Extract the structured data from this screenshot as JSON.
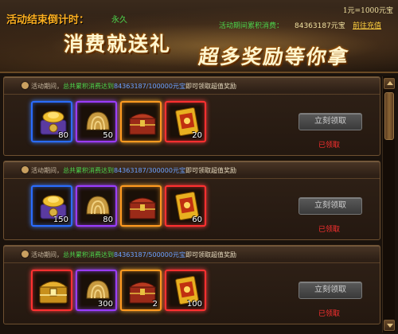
{
  "header": {
    "countdown_label": "活动结束倒计时：",
    "countdown_value": "永久",
    "rate": "1元=1000元宝",
    "total_label": "活动期间累积消费：",
    "total_value": "84363187元宝",
    "recharge_link": "前往充值",
    "slogan_left": "消费就送礼",
    "slogan_right": "超多奖励等你拿"
  },
  "tiers": [
    {
      "cond_prefix": "活动期间，",
      "cond_mid": "总共累积消费达到",
      "cond_amount": "84363187/100000元宝",
      "cond_suffix": "即可领取超值奖励",
      "button": "立刻领取",
      "status": "已领取",
      "items": [
        {
          "icon": "gold-ingot-box-icon",
          "quality": "blue",
          "qty": "80"
        },
        {
          "icon": "golden-shell-icon",
          "quality": "purple",
          "qty": "50"
        },
        {
          "icon": "treasure-chest-icon",
          "quality": "orange",
          "qty": ""
        },
        {
          "icon": "gold-voucher-icon",
          "quality": "red",
          "qty": "20"
        }
      ]
    },
    {
      "cond_prefix": "活动期间，",
      "cond_mid": "总共累积消费达到",
      "cond_amount": "84363187/300000元宝",
      "cond_suffix": "即可领取超值奖励",
      "button": "立刻领取",
      "status": "已领取",
      "items": [
        {
          "icon": "gold-ingot-box-icon",
          "quality": "blue",
          "qty": "150"
        },
        {
          "icon": "golden-shell-icon",
          "quality": "purple",
          "qty": "80"
        },
        {
          "icon": "treasure-chest-icon",
          "quality": "orange",
          "qty": ""
        },
        {
          "icon": "gold-voucher-icon",
          "quality": "red",
          "qty": "60"
        }
      ]
    },
    {
      "cond_prefix": "活动期间，",
      "cond_mid": "总共累积消费达到",
      "cond_amount": "84363187/500000元宝",
      "cond_suffix": "即可领取超值奖励",
      "button": "立刻领取",
      "status": "已领取",
      "items": [
        {
          "icon": "golden-chest-icon",
          "quality": "red",
          "qty": ""
        },
        {
          "icon": "golden-shell-icon",
          "quality": "purple",
          "qty": "300"
        },
        {
          "icon": "treasure-chest-icon",
          "quality": "orange",
          "qty": "2"
        },
        {
          "icon": "gold-voucher-icon",
          "quality": "red",
          "qty": "100"
        }
      ]
    }
  ],
  "colors": {
    "highlight_green": "#4cd54c",
    "amount_blue": "#6aa0ff",
    "claimed_red": "#ff3030",
    "title_orange": "#ffb020"
  }
}
